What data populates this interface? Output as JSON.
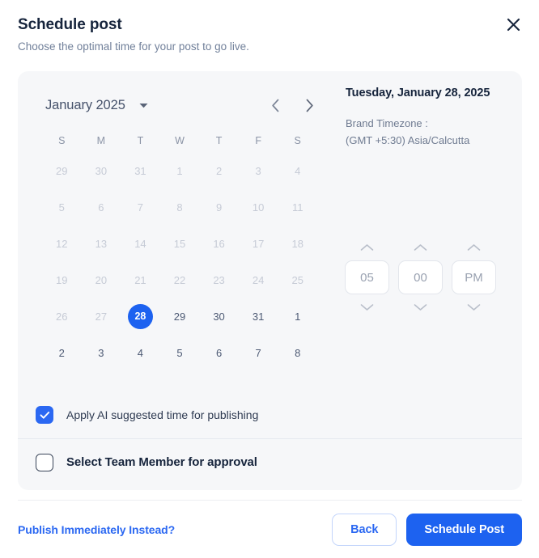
{
  "header": {
    "title": "Schedule post",
    "subtitle": "Choose the optimal time for your post to go live.",
    "close_icon": "close-icon"
  },
  "calendar": {
    "month_label": "January 2025",
    "dropdown_icon": "chevron-down-icon",
    "prev_icon": "chevron-left-icon",
    "next_icon": "chevron-right-icon",
    "day_headers": [
      "S",
      "M",
      "T",
      "W",
      "T",
      "F",
      "S"
    ],
    "weeks": [
      [
        {
          "d": "29",
          "state": "muted"
        },
        {
          "d": "30",
          "state": "muted"
        },
        {
          "d": "31",
          "state": "muted"
        },
        {
          "d": "1",
          "state": "muted"
        },
        {
          "d": "2",
          "state": "muted"
        },
        {
          "d": "3",
          "state": "muted"
        },
        {
          "d": "4",
          "state": "muted"
        }
      ],
      [
        {
          "d": "5",
          "state": "muted"
        },
        {
          "d": "6",
          "state": "muted"
        },
        {
          "d": "7",
          "state": "muted"
        },
        {
          "d": "8",
          "state": "muted"
        },
        {
          "d": "9",
          "state": "muted"
        },
        {
          "d": "10",
          "state": "muted"
        },
        {
          "d": "11",
          "state": "muted"
        }
      ],
      [
        {
          "d": "12",
          "state": "muted"
        },
        {
          "d": "13",
          "state": "muted"
        },
        {
          "d": "14",
          "state": "muted"
        },
        {
          "d": "15",
          "state": "muted"
        },
        {
          "d": "16",
          "state": "muted"
        },
        {
          "d": "17",
          "state": "muted"
        },
        {
          "d": "18",
          "state": "muted"
        }
      ],
      [
        {
          "d": "19",
          "state": "muted"
        },
        {
          "d": "20",
          "state": "muted"
        },
        {
          "d": "21",
          "state": "muted"
        },
        {
          "d": "22",
          "state": "muted"
        },
        {
          "d": "23",
          "state": "muted"
        },
        {
          "d": "24",
          "state": "muted"
        },
        {
          "d": "25",
          "state": "muted"
        }
      ],
      [
        {
          "d": "26",
          "state": "muted"
        },
        {
          "d": "27",
          "state": "muted"
        },
        {
          "d": "28",
          "state": "selected"
        },
        {
          "d": "29",
          "state": "enabled"
        },
        {
          "d": "30",
          "state": "enabled"
        },
        {
          "d": "31",
          "state": "enabled"
        },
        {
          "d": "1",
          "state": "enabled"
        }
      ],
      [
        {
          "d": "2",
          "state": "enabled"
        },
        {
          "d": "3",
          "state": "enabled"
        },
        {
          "d": "4",
          "state": "enabled"
        },
        {
          "d": "5",
          "state": "enabled"
        },
        {
          "d": "6",
          "state": "enabled"
        },
        {
          "d": "7",
          "state": "enabled"
        },
        {
          "d": "8",
          "state": "enabled"
        }
      ]
    ],
    "selected_day": "28"
  },
  "info": {
    "selected_date": "Tuesday, January 28, 2025",
    "timezone_label": "Brand Timezone :",
    "timezone_value": "(GMT +5:30) Asia/Calcutta"
  },
  "time": {
    "hour": "05",
    "minute": "00",
    "meridiem": "PM",
    "up_icon": "chevron-up-icon",
    "down_icon": "chevron-down-icon"
  },
  "options": [
    {
      "label": "Apply AI suggested time for publishing",
      "checked": true,
      "bold": false
    },
    {
      "label": "Select Team Member for approval",
      "checked": false,
      "bold": true
    }
  ],
  "footer": {
    "link": "Publish Immediately Instead?",
    "back": "Back",
    "submit": "Schedule Post"
  },
  "colors": {
    "accent_blue": "#1d62f0",
    "checkbox_blue": "#2b68f2",
    "card_bg": "#f6f7f9",
    "title_navy": "#16243c",
    "muted_text": "#c6cbd6"
  }
}
